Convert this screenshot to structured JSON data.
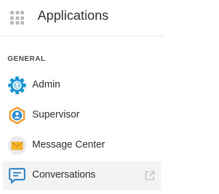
{
  "header": {
    "title": "Applications",
    "menu_icon": "app-grid-icon"
  },
  "section": {
    "label": "GENERAL"
  },
  "items": [
    {
      "label": "Admin",
      "icon": "admin-gear-icon"
    },
    {
      "label": "Supervisor",
      "icon": "supervisor-hexagon-icon"
    },
    {
      "label": "Message Center",
      "icon": "envelope-icon"
    },
    {
      "label": "Conversations",
      "icon": "chat-bubble-icon",
      "selected": true,
      "trailing_icon": "external-link-icon"
    }
  ],
  "colors": {
    "admin_blue": "#1a95d2",
    "supervisor_orange": "#f0a23a",
    "supervisor_blue": "#2d8fd5",
    "envelope_yellow": "#f4b32c",
    "envelope_bg": "#e9e9e9",
    "chat_blue": "#2f86c9",
    "active_bg": "#f3f3f3"
  }
}
